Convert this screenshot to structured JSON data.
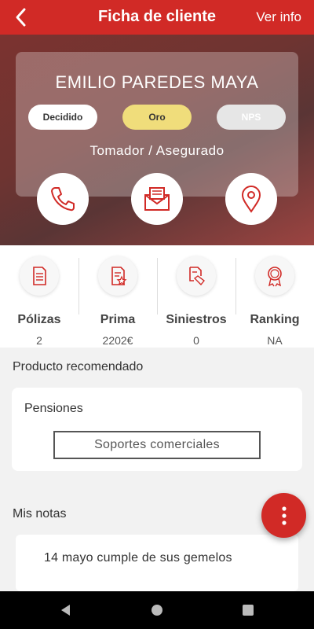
{
  "header": {
    "title": "Ficha de cliente",
    "action_label": "Ver info"
  },
  "client": {
    "name": "EMILIO PAREDES MAYA",
    "tags": [
      "Decidido",
      "Oro",
      "NPS"
    ],
    "role": "Tomador / Asegurado"
  },
  "contact_actions": [
    "phone-icon",
    "mail-icon",
    "location-icon"
  ],
  "stats": [
    {
      "label": "Pólizas",
      "value": "2",
      "icon": "document-icon"
    },
    {
      "label": "Prima",
      "value": "2202€",
      "icon": "document-star-icon"
    },
    {
      "label": "Siniestros",
      "value": "0",
      "icon": "claim-icon"
    },
    {
      "label": "Ranking",
      "value": "NA",
      "icon": "medal-icon"
    }
  ],
  "recommended": {
    "section_title": "Producto recomendado",
    "product": "Pensiones",
    "button_label": "Soportes comerciales"
  },
  "notes": {
    "section_title": "Mis notas",
    "items": [
      "14 mayo cumple de sus gemelos"
    ]
  },
  "colors": {
    "brand_red": "#d12a26",
    "gold_tag": "#f0dd7b"
  }
}
